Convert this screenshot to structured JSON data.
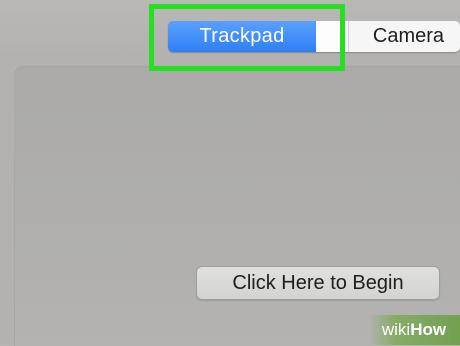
{
  "tabs": [
    {
      "label": "Trackpad",
      "selected": true
    },
    {
      "label": "Camera",
      "selected": false
    }
  ],
  "main": {
    "begin_button_label": "Click Here to Begin"
  },
  "watermark": {
    "prefix": "wiki",
    "suffix": "How"
  },
  "colors": {
    "selected_tab": "#2f7ff4",
    "highlight": "#25e021",
    "background": "#b5b4b2"
  }
}
